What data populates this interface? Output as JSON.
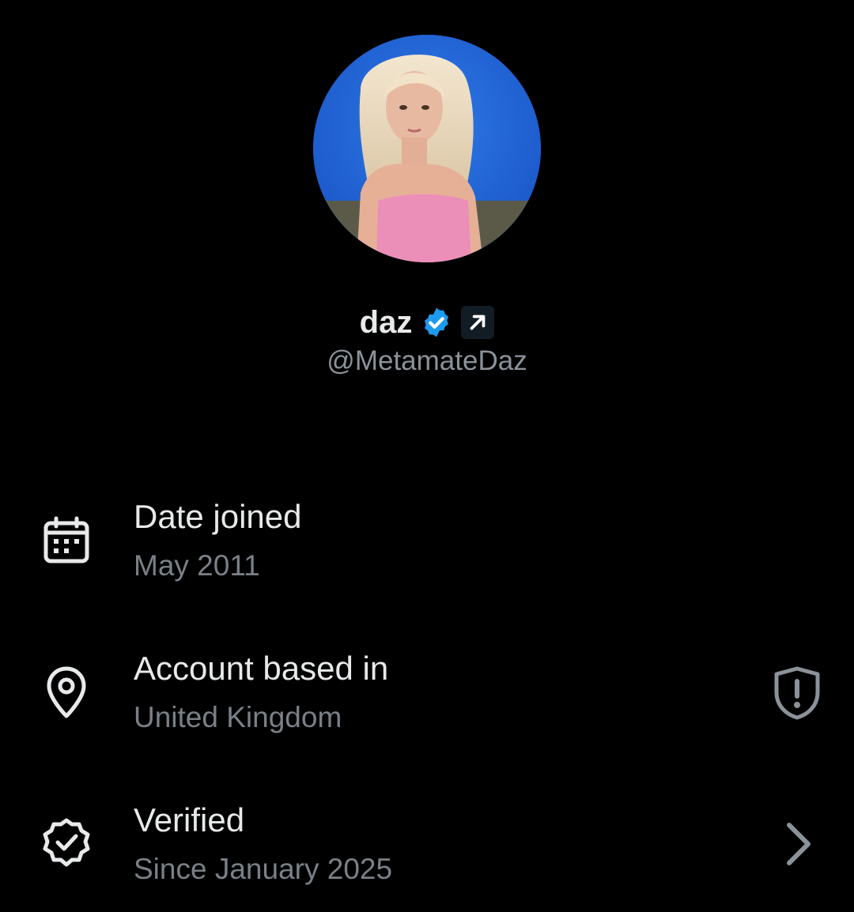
{
  "profile": {
    "display_name": "daz",
    "handle": "@MetamateDaz",
    "avatar_icon": "profile-photo",
    "badges": [
      "verified-check-icon",
      "affiliate-arrow-icon"
    ]
  },
  "details": {
    "date_joined": {
      "icon": "calendar-icon",
      "title": "Date joined",
      "value": "May 2011"
    },
    "account_based_in": {
      "icon": "location-pin-icon",
      "title": "Account based in",
      "value": "United Kingdom",
      "trailing_icon": "shield-alert-icon"
    },
    "verified": {
      "icon": "verified-badge-icon",
      "title": "Verified",
      "value": "Since January 2025",
      "trailing_icon": "chevron-right-icon"
    }
  },
  "colors": {
    "background": "#000000",
    "primary_text": "#e7e9ea",
    "secondary_text": "#7a8087",
    "verified_blue": "#1d9bf0"
  }
}
